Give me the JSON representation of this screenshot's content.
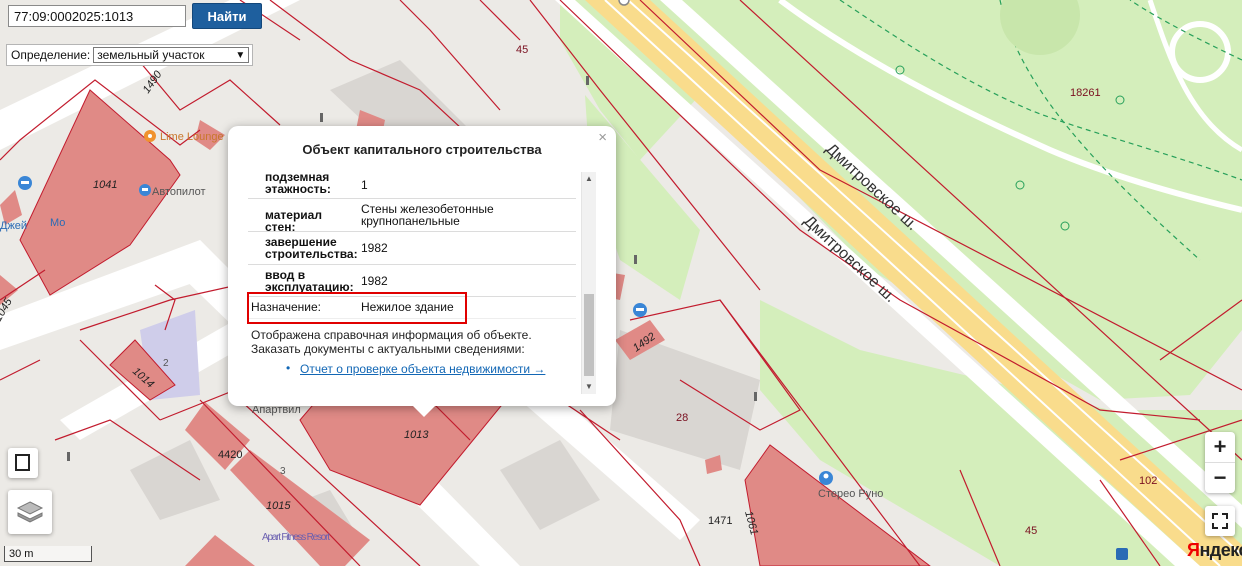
{
  "search": {
    "value": "77:09:0002025:1013",
    "button_label": "Найти"
  },
  "definition": {
    "label": "Определение:",
    "selected": "земельный участок"
  },
  "popup": {
    "title": "Объект капитального строительства",
    "close_glyph": "×",
    "rows": [
      {
        "label": "подземная этажность:",
        "value": "1"
      },
      {
        "label": "материал стен:",
        "value": "Стены железобетонные крупнопанельные"
      },
      {
        "label": "завершение строительства:",
        "value": "1982"
      },
      {
        "label": "ввод в эксплуатацию:",
        "value": "1982"
      },
      {
        "label": "Назначение:",
        "value": "Нежилое здание"
      }
    ],
    "note": "Отображена справочная информация об объекте. Заказать документы с актуальными сведениями:",
    "report_link": "Отчет о проверке объекта недвижимости →"
  },
  "map": {
    "roads": [
      {
        "name": "Дмитровское ш."
      },
      {
        "name": "Дмитровское ш."
      }
    ],
    "building_numbers": [
      "1041",
      "1014",
      "1013",
      "1015",
      "4420",
      "1492",
      "1061",
      "1490",
      "1045",
      "1471"
    ],
    "parcel_numbers": [
      "45",
      "18261",
      "28",
      "102",
      "45"
    ],
    "small_labels": [
      "2",
      "3"
    ],
    "pois": [
      {
        "name": "Lime Lounge",
        "icon": "bar-icon"
      },
      {
        "name": "Автопилот",
        "icon": "car-service-icon"
      },
      {
        "name": "Мо",
        "icon": ""
      },
      {
        "name": "Джей",
        "icon": ""
      },
      {
        "name": "Апартвил",
        "icon": ""
      },
      {
        "name": "Apart Fitness Resort",
        "icon": ""
      },
      {
        "name": "Стерео Руно",
        "icon": "shop-icon"
      }
    ],
    "controls": {
      "zoom_in": "+",
      "zoom_out": "−",
      "scale": "30 m"
    },
    "logo": "Яндекс",
    "colors": {
      "building": "#e08a86",
      "parcel_border": "#c21c2e",
      "road": "#f9dc8c",
      "park": "#d4eebb",
      "accent": "#1e5f9e",
      "highlight": "#e00000"
    }
  }
}
